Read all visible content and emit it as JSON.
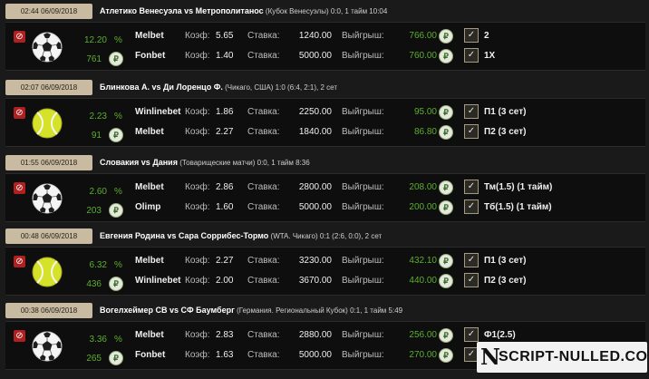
{
  "labels": {
    "coef": "Коэф:",
    "stake": "Ставка:",
    "win": "Выйгрыш:",
    "pct_sign": "%",
    "coin": "₽",
    "stop": "⊘",
    "check": "✓"
  },
  "colors": {
    "header_bg": "#c9bba2",
    "profit_green": "#5cae2e",
    "stop_red": "#b02020",
    "row_bg": "#0e0e0e"
  },
  "cards": [
    {
      "time": "02:44 06/09/2018",
      "match": "Атлетико Венесуэла vs Метрополитанос",
      "info": "(Кубок Венесуэлы) 0:0, 1 тайм 10:04",
      "sport_icon": "soccer-ball-icon",
      "percent": "12.20",
      "profit": "761",
      "bets": [
        {
          "bookmaker": "Melbet",
          "coef": "5.65",
          "stake": "1240.00",
          "win": "766.00",
          "outcome": "2"
        },
        {
          "bookmaker": "Fonbet",
          "coef": "1.40",
          "stake": "5000.00",
          "win": "760.00",
          "outcome": "1X"
        }
      ]
    },
    {
      "time": "02:07 06/09/2018",
      "match": "Блинкова А. vs Ди Лоренцо Ф.",
      "info": "(Чикаго, США) 1:0 (6:4, 2:1), 2 сет",
      "sport_icon": "tennis-ball-icon",
      "percent": "2.23",
      "profit": "91",
      "bets": [
        {
          "bookmaker": "Winlinebet",
          "coef": "1.86",
          "stake": "2250.00",
          "win": "95.00",
          "outcome": "П1 (3 сет)"
        },
        {
          "bookmaker": "Melbet",
          "coef": "2.27",
          "stake": "1840.00",
          "win": "86.80",
          "outcome": "П2 (3 сет)"
        }
      ]
    },
    {
      "time": "01:55 06/09/2018",
      "match": "Словакия vs Дания",
      "info": "(Товарищеские матчи) 0:0, 1 тайм 8:36",
      "sport_icon": "soccer-ball-icon",
      "percent": "2.60",
      "profit": "203",
      "bets": [
        {
          "bookmaker": "Melbet",
          "coef": "2.86",
          "stake": "2800.00",
          "win": "208.00",
          "outcome": "Тм(1.5) (1 тайм)"
        },
        {
          "bookmaker": "Olimp",
          "coef": "1.60",
          "stake": "5000.00",
          "win": "200.00",
          "outcome": "Тб(1.5) (1 тайм)"
        }
      ]
    },
    {
      "time": "00:48 06/09/2018",
      "match": "Евгения Родина vs Сара Соррибес-Тормо",
      "info": "(WTA. Чикаго) 0:1 (2:6, 0:0), 2 сет",
      "sport_icon": "tennis-ball-icon",
      "percent": "6.32",
      "profit": "436",
      "bets": [
        {
          "bookmaker": "Melbet",
          "coef": "2.27",
          "stake": "3230.00",
          "win": "432.10",
          "outcome": "П1 (3 сет)"
        },
        {
          "bookmaker": "Winlinebet",
          "coef": "2.00",
          "stake": "3670.00",
          "win": "440.00",
          "outcome": "П2 (3 сет)"
        }
      ]
    },
    {
      "time": "00:38 06/09/2018",
      "match": "Вогелхеймер СВ vs СФ Баумберг",
      "info": "(Германия. Региональный Кубок) 0:1, 1 тайм 5:49",
      "sport_icon": "soccer-ball-icon",
      "percent": "3.36",
      "profit": "265",
      "bets": [
        {
          "bookmaker": "Melbet",
          "coef": "2.83",
          "stake": "2880.00",
          "win": "256.00",
          "outcome": "Ф1(2.5)"
        },
        {
          "bookmaker": "Fonbet",
          "coef": "1.63",
          "stake": "5000.00",
          "win": "270.00",
          "outcome": ""
        }
      ]
    }
  ],
  "watermark": {
    "mark": "N",
    "text": "SCRIPT-NULLED.CO"
  }
}
